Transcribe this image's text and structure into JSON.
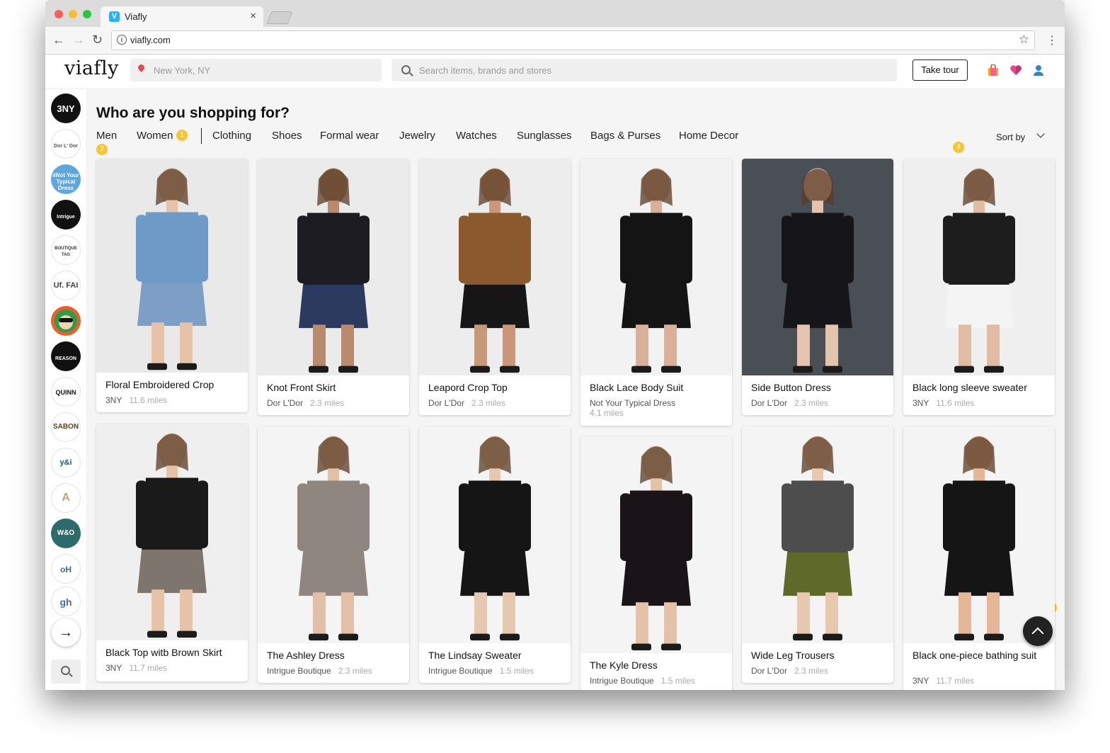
{
  "browser": {
    "tab_title": "Viafly",
    "tab_favicon": "V",
    "url": "viafly.com"
  },
  "header": {
    "logo": "viafly",
    "location_placeholder": "New York, NY",
    "search_placeholder": "Search items, brands and stores",
    "tour_label": "Take tour",
    "icons": [
      "shopping-bag-icon",
      "heart-icon",
      "user-icon"
    ]
  },
  "sidebar": {
    "stores": [
      {
        "name": "3NY",
        "label": "3NY",
        "bg": "#111111",
        "fg": "#ffffff"
      },
      {
        "name": "dor-l-dor",
        "label": "Dor L' Dor",
        "bg": "#ffffff",
        "fg": "#555555"
      },
      {
        "name": "not-your-typical-dress",
        "label": "#Not Your Typical Dress",
        "bg": "#5fa6dc",
        "fg": "#ffffff"
      },
      {
        "name": "intrigue",
        "label": "Intrigue",
        "bg": "#111111",
        "fg": "#ffffff"
      },
      {
        "name": "boutique-tag",
        "label": "BOUTIQUE TAG",
        "bg": "#ffffff",
        "fg": "#333333"
      },
      {
        "name": "uf-fai",
        "label": "Uf. FAI",
        "bg": "#ffffff",
        "fg": "#444444"
      },
      {
        "name": "monkey-store",
        "label": "",
        "bg": "#e8612c",
        "fg": "#ffffff"
      },
      {
        "name": "reason",
        "label": "REASON",
        "bg": "#111111",
        "fg": "#ffffff"
      },
      {
        "name": "quinn",
        "label": "QUINN",
        "bg": "#ffffff",
        "fg": "#111111"
      },
      {
        "name": "sabon",
        "label": "SABON",
        "bg": "#ffffff",
        "fg": "#5a3e1b"
      },
      {
        "name": "ysi",
        "label": "y&i",
        "bg": "#ffffff",
        "fg": "#1a5c74"
      },
      {
        "name": "a-20",
        "label": "A",
        "bg": "#ffffff",
        "fg": "#c9a27a"
      },
      {
        "name": "w-and-o",
        "label": "W&O",
        "bg": "#2c6b6b",
        "fg": "#ffffff"
      },
      {
        "name": "oh",
        "label": "oH",
        "bg": "#ffffff",
        "fg": "#3a6a9a"
      },
      {
        "name": "gh",
        "label": "gh",
        "bg": "#ffffff",
        "fg": "#4a6aa8"
      }
    ]
  },
  "main": {
    "heading": "Who are you shopping for?",
    "categories": [
      "Men",
      "Women",
      "Clothing",
      "Shoes",
      "Formal wear",
      "Jewelry",
      "Watches",
      "Sunglasses",
      "Bags & Purses",
      "Home Decor"
    ],
    "sort_label": "Sort by",
    "badges": [
      "1",
      "2",
      "3",
      "4"
    ]
  },
  "products": [
    {
      "name": "Floral Embroidered Crop",
      "store": "3NY",
      "distance": "11.6 miles",
      "bg": "#e9e9e9",
      "top": "#6d9ac7",
      "bottom": "#7d9fc6",
      "skin": "#e6c2a6"
    },
    {
      "name": "Knot Front Skirt",
      "store": "Dor L'Dor",
      "distance": "2.3 miles",
      "bg": "#ebebeb",
      "top": "#1c1c22",
      "bottom": "#2c3a60",
      "skin": "#b88a6e"
    },
    {
      "name": "Leapord Crop Top",
      "store": "Dor L'Dor",
      "distance": "2.3 miles",
      "bg": "#ededed",
      "top": "#8a5a2e",
      "bottom": "#161616",
      "skin": "#c9987a"
    },
    {
      "name": "Black Lace Body Suit",
      "store": "Not Your Typical Dress",
      "distance": "4.1 miles",
      "bg": "#f2f2f2",
      "top": "#141414",
      "bottom": "#141414",
      "skin": "#d9b09a"
    },
    {
      "name": "Side Button Dress",
      "store": "Dor L'Dor",
      "distance": "2.3 miles",
      "bg": "#4a4e55",
      "top": "#15151a",
      "bottom": "#15151a",
      "skin": "#e5c4ae"
    },
    {
      "name": "Black long sleeve sweater",
      "store": "3NY",
      "distance": "11.6 miles",
      "bg": "#efefef",
      "top": "#1d1d1d",
      "bottom": "#f4f4f4",
      "skin": "#e0bca4"
    },
    {
      "name": "Black Top witb Brown Skirt",
      "store": "3NY",
      "distance": "11.7 miles",
      "bg": "#efefef",
      "top": "#1a1a1a",
      "bottom": "#7e756e",
      "skin": "#e6c2a6"
    },
    {
      "name": "The Ashley Dress",
      "store": "Intrigue Boutique",
      "distance": "2.3 miles",
      "bg": "#f4f4f4",
      "top": "#8f8680",
      "bottom": "#8f8680",
      "skin": "#e1c0a7"
    },
    {
      "name": "The Lindsay Sweater",
      "store": "Intrigue Boutique",
      "distance": "1.5 miles",
      "bg": "#f4f4f4",
      "top": "#151515",
      "bottom": "#151515",
      "skin": "#e6c7b0"
    },
    {
      "name": "The Kyle Dress",
      "store": "Intrigue Boutique",
      "distance": "1.5 miles",
      "bg": "#f4f4f4",
      "top": "#1a1418",
      "bottom": "#1a1418",
      "skin": "#e3c2a8"
    },
    {
      "name": "Wide Leg Trousers",
      "store": "Dor L'Dor",
      "distance": "2.3 miles",
      "bg": "#f4f4f4",
      "top": "#4d4d4d",
      "bottom": "#5f6a2a",
      "skin": "#e9c8b0"
    },
    {
      "name": "Black one-piece bathing suit",
      "store": "3NY",
      "distance": "11.7 miles",
      "bg": "#f4f4f4",
      "top": "#151515",
      "bottom": "#151515",
      "skin": "#e3b798"
    }
  ]
}
